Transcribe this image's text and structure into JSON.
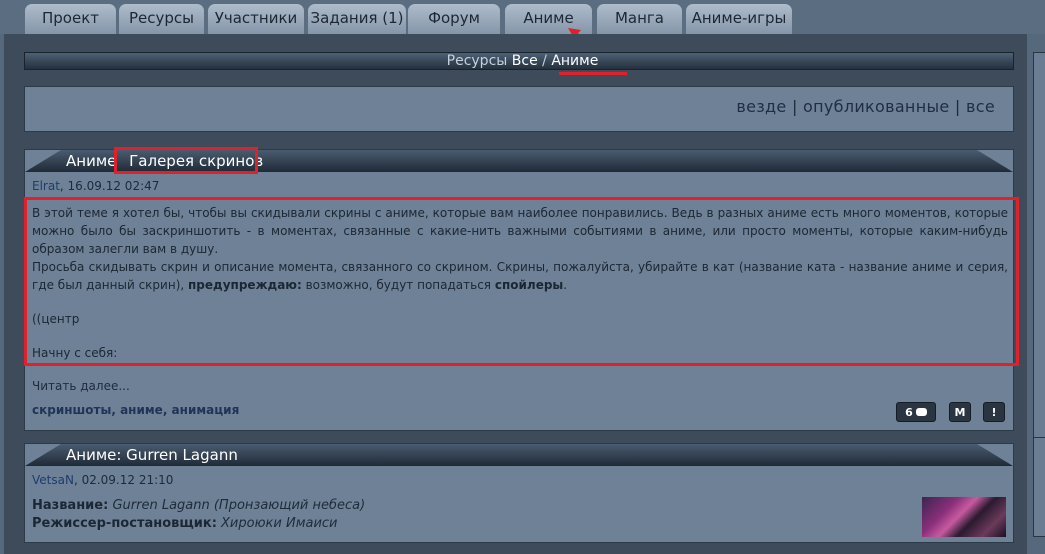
{
  "tabs": [
    "Проект",
    "Ресурсы",
    "Участники",
    "Задания (1)",
    "Форум",
    "Аниме",
    "Манга",
    "Аниме-игры"
  ],
  "breadcrumb": {
    "prefix": "Ресурсы",
    "all": "Все",
    "sep": "/",
    "current": "Аниме"
  },
  "filters": {
    "everywhere": "везде",
    "sep1": "|",
    "published": "опубликованные",
    "sep2": "|",
    "all": "все"
  },
  "post1": {
    "category": "Аниме",
    "title": "Галерея скринов",
    "author": "Elrat",
    "date": ", 16.09.12 02:47",
    "para1": "В этой теме я хотел бы, чтобы вы скидывали скрины с аниме, которые вам наиболее понравились. Ведь в разных аниме есть много моментов, которые можно было бы заскриншотить - в моментах, связанные с какие-нить важными событиями в аниме, или просто моменты, которые каким-нибудь образом залегли вам в душу.",
    "para2_start": "Просьба скидывать скрин и описание момента, связанного со скрином. Скрины, пожалуйста, убирайте в кат (название ката - название аниме и серия, где был данный скрин), ",
    "para2_bold1": "предупреждаю:",
    "para2_mid": " возможно, будут попадаться ",
    "para2_bold2": "спойлеры",
    "para2_end": ".",
    "line3": "((центр",
    "line4": "Начну с себя:",
    "read_more": "Читать далее...",
    "tags": "скриншоты, аниме, анимация",
    "comments_count": "6",
    "btn_m": "М",
    "btn_excl": "!"
  },
  "post2": {
    "title": "Аниме: Gurren Lagann",
    "author": "VetsaN",
    "date": ", 02.09.12 21:10",
    "name_label": "Название:",
    "name_value": "Gurren Lagann (Пронзающий небеса)",
    "director_label": "Режиссер-постановщик:",
    "director_value": "Хироюки Имаиси"
  },
  "colors": {
    "highlight": "#e0202a",
    "background": "#56687c",
    "panel": "#6e8196"
  }
}
